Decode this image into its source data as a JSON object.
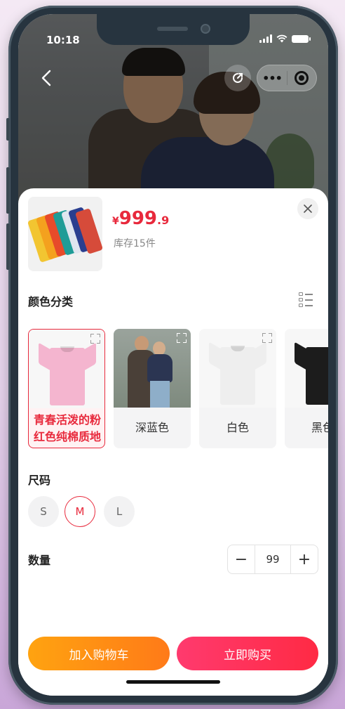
{
  "status_bar": {
    "time": "10:18"
  },
  "nav": {
    "back_icon": "chevron-left-icon",
    "share_icon": "share-icon",
    "more_icon": "more-dots-icon",
    "close_icon": "target-icon"
  },
  "product": {
    "currency": "¥",
    "price_int": "999",
    "price_dec": ".9",
    "stock": "库存15件"
  },
  "color_section": {
    "title": "颜色分类",
    "options": [
      {
        "label": "青春活泼的粉红色纯棉质地",
        "color": "#f4b5cf",
        "selected": true
      },
      {
        "label": "深蓝色",
        "color": "#2b3552",
        "selected": false
      },
      {
        "label": "白色",
        "color": "#f0f0f0",
        "selected": false
      },
      {
        "label": "黑色",
        "color": "#1c1c1c",
        "selected": false
      }
    ]
  },
  "size_section": {
    "title": "尺码",
    "options": [
      {
        "label": "S",
        "selected": false
      },
      {
        "label": "M",
        "selected": true
      },
      {
        "label": "L",
        "selected": false
      }
    ]
  },
  "quantity_section": {
    "title": "数量",
    "value": "99",
    "minus": "−",
    "plus": "+"
  },
  "actions": {
    "add_to_cart": "加入购物车",
    "buy_now": "立即购买"
  },
  "colors": {
    "accent": "#e8293c",
    "cart_orange": "#ff8a14",
    "buy_red": "#ff2a44"
  }
}
